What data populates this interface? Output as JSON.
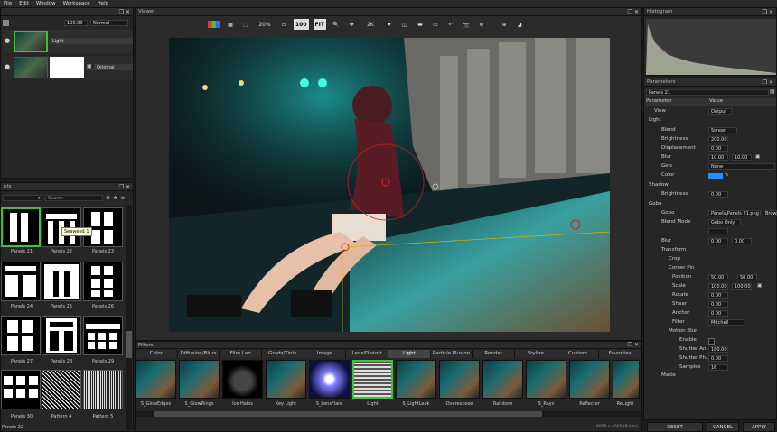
{
  "menu": [
    "File",
    "Edit",
    "Window",
    "Workspace",
    "Help"
  ],
  "layers": {
    "opacity": "100.00",
    "mode": "Normal",
    "layer1": "Light",
    "layer2": "Original"
  },
  "viewer": {
    "title": "Viewer",
    "zoom": "20%",
    "size_label": "100",
    "fit_label": "FIT",
    "res": "2K",
    "status": "6000 x 4000 (8 bits)"
  },
  "filters_browser": {
    "search_placeholder": "Search",
    "tooltip": "Seaweed 1",
    "items": [
      {
        "name": "Panels 21"
      },
      {
        "name": "Panels 22"
      },
      {
        "name": "Panels 23"
      },
      {
        "name": "Panels 24"
      },
      {
        "name": "Panels 25"
      },
      {
        "name": "Panels 26"
      },
      {
        "name": "Panels 27"
      },
      {
        "name": "Panels 28"
      },
      {
        "name": "Panels 29"
      },
      {
        "name": "Panels 30"
      },
      {
        "name": "Pattern 4"
      },
      {
        "name": "Pattern 5"
      }
    ],
    "status": "Panels 22"
  },
  "filters": {
    "title": "Filters",
    "tabs": [
      "Color",
      "Diffusion/Blurs",
      "Film Lab",
      "Grads/Tints",
      "Image",
      "Lens/Distort",
      "Light",
      "Particle Illusion",
      "Render",
      "Stylize",
      "Custom",
      "Favorites"
    ],
    "active_tab": "Light",
    "items": [
      "S_GlowEdges",
      "S_GlowRings",
      "Ice Halos",
      "Key Light",
      "S_LensFlare",
      "Light",
      "S_LightLeak",
      "Overexpose",
      "Rainbow",
      "S_Rays",
      "Reflector",
      "ReLight"
    ]
  },
  "histogram": {
    "title": "Histogram"
  },
  "parameters": {
    "title": "Parameters",
    "node": "Panels 21",
    "col_param": "Parameter",
    "col_value": "Value",
    "rows": [
      {
        "label": "View",
        "value": "Output"
      },
      {
        "label": "Light",
        "value": ""
      },
      {
        "label": "Blend",
        "value": "Screen"
      },
      {
        "label": "Brightness",
        "value": "200.00"
      },
      {
        "label": "Displacement",
        "value": "0.00"
      },
      {
        "label": "Blur",
        "value": "10.00"
      },
      {
        "label": "Gels",
        "value": "None"
      },
      {
        "label": "Color",
        "value": ""
      },
      {
        "label": "Shadow",
        "value": ""
      },
      {
        "label": "Brightness",
        "value": "0.00"
      },
      {
        "label": "Gobo",
        "value": ""
      },
      {
        "label": "Gobo",
        "value": "Panels\\Panels 21.png"
      },
      {
        "label": "Blend Mode",
        "value": "Gobo Only"
      },
      {
        "label": "",
        "value": ""
      },
      {
        "label": "Blur",
        "value": "0.00"
      },
      {
        "label": "Transform",
        "value": ""
      },
      {
        "label": "Crop",
        "value": ""
      },
      {
        "label": "Corner Pin",
        "value": ""
      },
      {
        "label": "Position",
        "value": "50.00"
      },
      {
        "label": "Scale",
        "value": "100.00"
      },
      {
        "label": "Rotate",
        "value": "0.00"
      },
      {
        "label": "Shear",
        "value": "0.00"
      },
      {
        "label": "Anchor",
        "value": "0.00"
      },
      {
        "label": "Filter",
        "value": "Mitchell"
      },
      {
        "label": "Motion Blur",
        "value": ""
      },
      {
        "label": "Enable",
        "value": ""
      },
      {
        "label": "Shutter An...",
        "value": "180.00"
      },
      {
        "label": "Shutter Ph...",
        "value": "0.00"
      },
      {
        "label": "Samples",
        "value": "16"
      },
      {
        "label": "",
        "value": ""
      },
      {
        "label": "Matte",
        "value": ""
      }
    ],
    "browse": "Browse",
    "pos_y": "50.00",
    "scale_y": "100.00",
    "blur2": "0.00",
    "gobo_blur2": "0.00"
  },
  "buttons": {
    "reset": "RESET",
    "cancel": "CANCEL",
    "apply": "APPLY"
  },
  "colors": {
    "accent_green": "#3bc33b",
    "cyan": "#00b4c8",
    "blue_swatch": "#1e8fff"
  }
}
